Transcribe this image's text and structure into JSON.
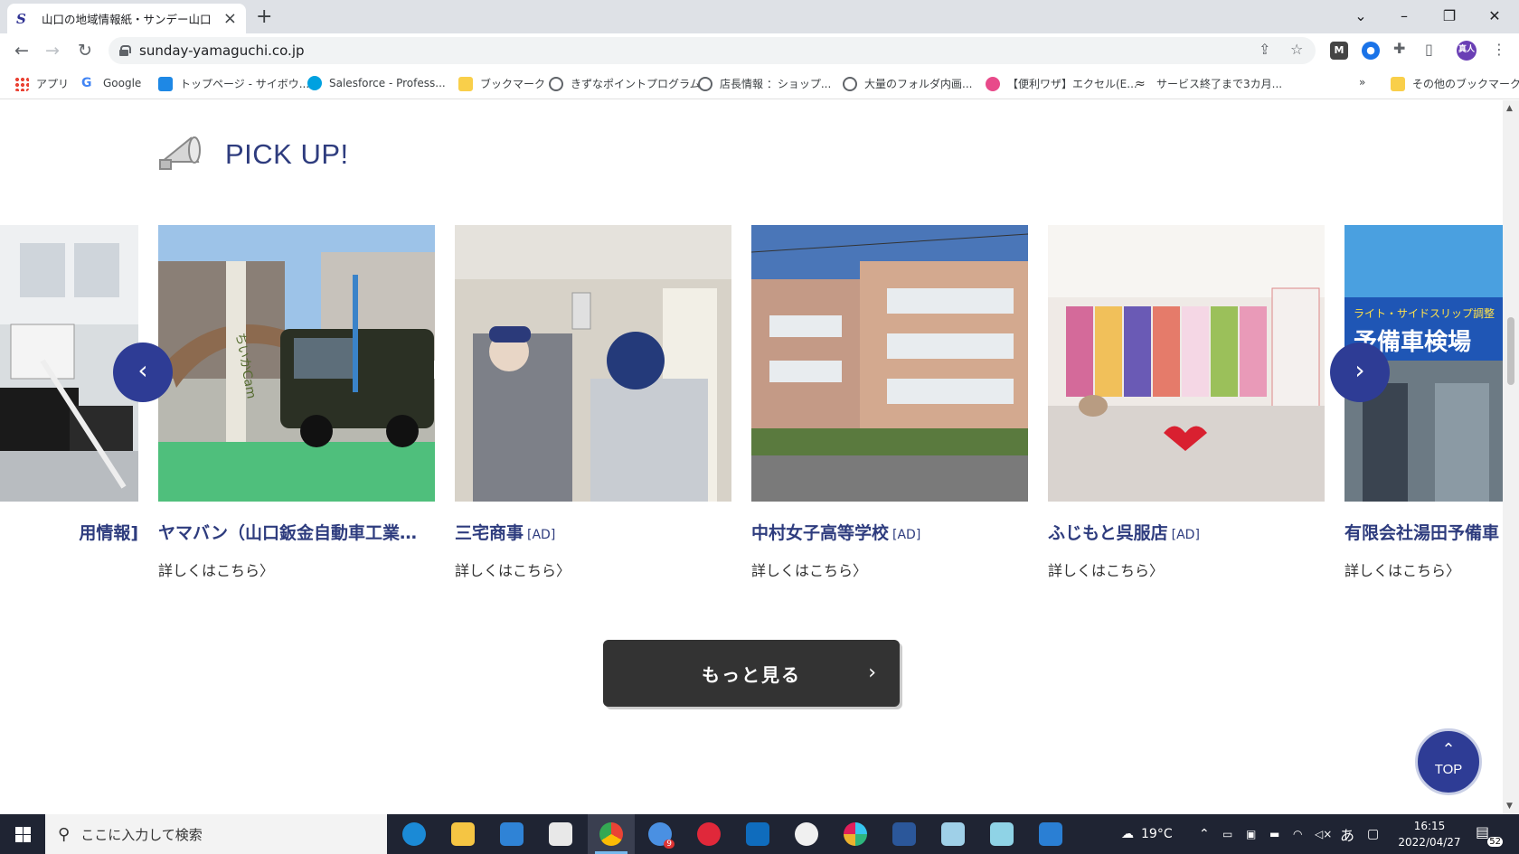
{
  "browser": {
    "tab_title": "山口の地域情報紙・サンデー山口",
    "favicon_letter": "S",
    "url": "sunday-yamaguchi.co.jp",
    "profile_initials": "真人"
  },
  "bookmarks": [
    {
      "label": "アプリ",
      "icon": "apps-icon"
    },
    {
      "label": "Google",
      "icon": "google-icon"
    },
    {
      "label": "トップページ - サイボウ...",
      "icon": "cybozu-icon"
    },
    {
      "label": "Salesforce - Profess...",
      "icon": "salesforce-icon"
    },
    {
      "label": "ブックマーク",
      "icon": "folder-icon"
    },
    {
      "label": "きずなポイントプログラム",
      "icon": "globe-icon"
    },
    {
      "label": "店長情報 ：ショップ...",
      "icon": "globe-icon"
    },
    {
      "label": "大量のフォルダ内画...",
      "icon": "globe-icon"
    },
    {
      "label": "【便利ワザ】エクセル(E...",
      "icon": "pink-icon"
    },
    {
      "label": "サービス終了まで3カ月...",
      "icon": "wave-icon"
    }
  ],
  "bookmarks_overflow": "»",
  "bookmarks_other": "その他のブックマーク",
  "page": {
    "section_title": "PICK UP!",
    "cards": [
      {
        "title": "用情報]",
        "ad": "",
        "more": ""
      },
      {
        "title": "ヤマバン（山口鈑金自動車工業…",
        "ad": "",
        "more": "詳しくはこちら〉"
      },
      {
        "title": "三宅商事",
        "ad": "[AD]",
        "more": "詳しくはこちら〉"
      },
      {
        "title": "中村女子高等学校",
        "ad": "[AD]",
        "more": "詳しくはこちら〉"
      },
      {
        "title": "ふじもと呉服店",
        "ad": "[AD]",
        "more": "詳しくはこちら〉"
      },
      {
        "title": "有限会社湯田予備車",
        "ad": "",
        "more": "詳しくはこちら〉"
      }
    ],
    "prev_arrow": "‹",
    "next_arrow": "›",
    "more_button": "もっと見る",
    "more_chevron": "›",
    "top_caret": "⌃",
    "top_label": "TOP"
  },
  "photo_texts": {
    "shop_sign": "予備車検場",
    "shop_sub": "ライト・サイドスリップ調整",
    "flag": "ちいかCam"
  },
  "taskbar": {
    "search_placeholder": "ここに入力して検索",
    "weather": "19°C",
    "ime": "あ",
    "time": "16:15",
    "date": "2022/04/27",
    "notifications": "52",
    "mail_badge": "9"
  },
  "colors": {
    "brand_navy": "#2e3c95",
    "title_navy": "#2e3c7e",
    "button_dark": "#333333"
  }
}
